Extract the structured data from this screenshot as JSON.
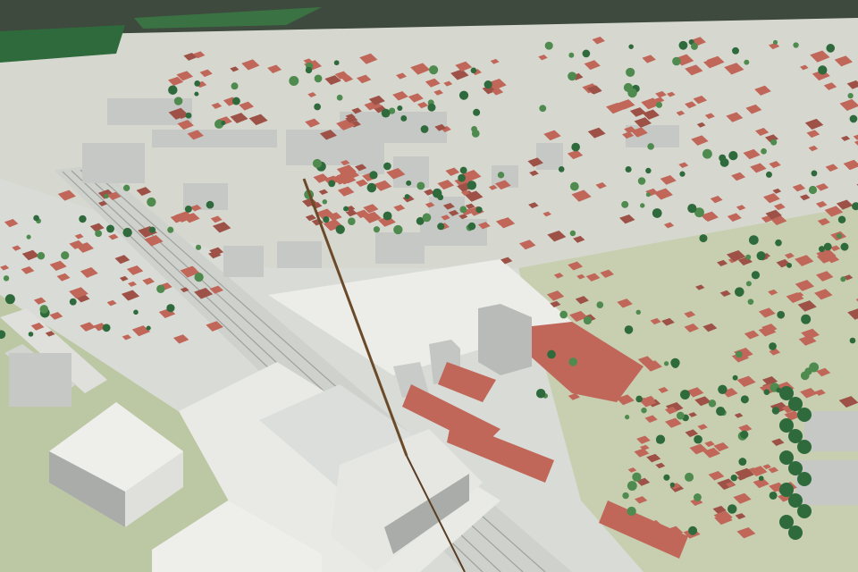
{
  "scene": {
    "subject": "architectural-city-model",
    "colors": {
      "background_top": "#3e4a3d",
      "base_white": "#e9eae6",
      "grass": "#bcc7a4",
      "grass_dark": "#a9b58f",
      "road": "#cfd1cc",
      "rail": "#b7b9b4",
      "roof_red": "#c0675a",
      "roof_red_dark": "#9e5247",
      "block_white": "#dfe0dc",
      "block_shadow": "#a9aca8",
      "tower_grey": "#b9bbb9",
      "tree": "#2f6a3c",
      "tree_light": "#4f8a4e",
      "pointer": "#6b4a2a"
    }
  }
}
